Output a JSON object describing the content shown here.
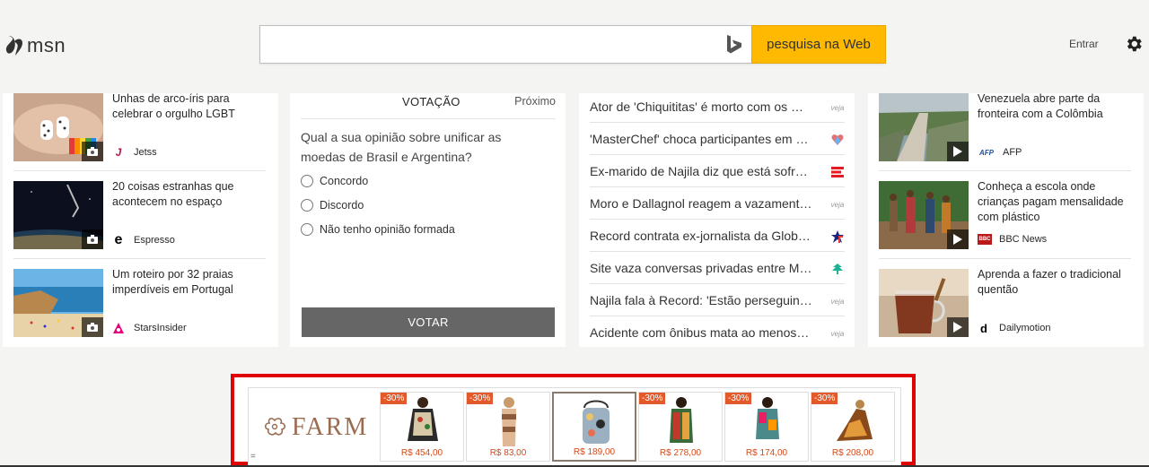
{
  "header": {
    "logo_text": "msn",
    "search_placeholder": "",
    "search_button": "pesquisa na Web",
    "signin": "Entrar",
    "colors": {
      "search_button": "#ffb900",
      "background": "#f4f4f2"
    }
  },
  "col1": {
    "items": [
      {
        "title": "Unhas de arco-íris para celebrar o orgulho LGBT",
        "source": "Jetss",
        "media": "camera-icon"
      },
      {
        "title": "20 coisas estranhas que acontecem no espaço",
        "source": "Espresso",
        "media": "camera-icon"
      },
      {
        "title": "Um roteiro por 32 praias imperdíveis em Portugal",
        "source": "StarsInsider",
        "media": "camera-icon"
      }
    ]
  },
  "poll": {
    "title": "VOTAÇÃO",
    "next": "Próximo",
    "question": "Qual a sua opinião sobre unificar as moedas de Brasil e Argentina?",
    "options": [
      "Concordo",
      "Discordo",
      "Não tenho opinião formada"
    ],
    "vote_button": "VOTAR"
  },
  "headlines": {
    "items": [
      {
        "text": "Ator de 'Chiquititas' é morto com os …",
        "logo": "veja"
      },
      {
        "text": "'MasterChef' choca participantes em …",
        "logo": "heart-logo"
      },
      {
        "text": "Ex-marido de Najila diz que está sofr…",
        "logo": "red-e-logo"
      },
      {
        "text": "Moro e Dallagnol reagem a vazament…",
        "logo": "veja"
      },
      {
        "text": "Record contrata ex-jornalista da Glob…",
        "logo": "star-logo"
      },
      {
        "text": "Site vaza conversas privadas entre M…",
        "logo": "tree-logo"
      },
      {
        "text": "Najila fala à Record: 'Estão perseguin…",
        "logo": "veja"
      },
      {
        "text": "Acidente com ônibus mata ao menos…",
        "logo": "veja"
      }
    ]
  },
  "col4": {
    "items": [
      {
        "title": "Venezuela abre parte da fronteira com a Colômbia",
        "source": "AFP",
        "source_logo": "AFP",
        "media": "play-icon"
      },
      {
        "title": "Conheça a escola onde crianças pagam mensalidade com plástico",
        "source": "BBC News",
        "source_logo": "BBC",
        "media": "play-icon"
      },
      {
        "title": "Aprenda a fazer o tradicional quentão",
        "source": "Dailymotion",
        "source_logo": "d",
        "media": "play-icon"
      }
    ]
  },
  "ad": {
    "brand": "FARM",
    "corner_label": "=",
    "products": [
      {
        "discount": "-30%",
        "price": "R$ 454,00"
      },
      {
        "discount": "-30%",
        "price": "R$ 83,00"
      },
      {
        "discount": "",
        "price": "R$ 189,00"
      },
      {
        "discount": "-30%",
        "price": "R$ 278,00"
      },
      {
        "discount": "-30%",
        "price": "R$ 174,00"
      },
      {
        "discount": "-30%",
        "price": "R$ 208,00"
      }
    ],
    "colors": {
      "frame": "#e00000",
      "discount": "#e25a2c",
      "price": "#d44a1a"
    }
  }
}
